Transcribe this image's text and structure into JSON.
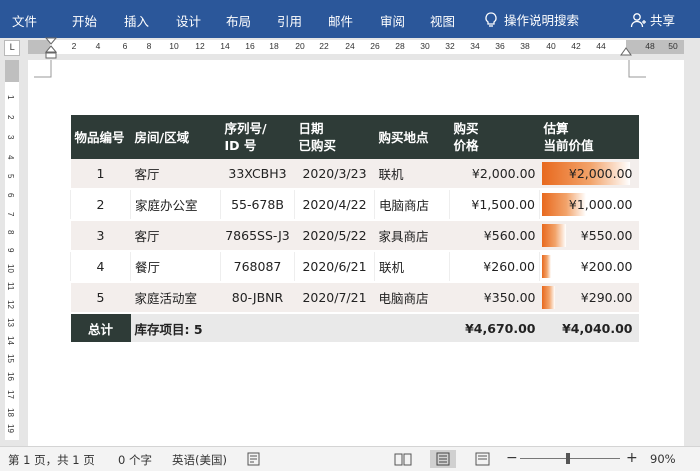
{
  "ribbon": {
    "tabs": [
      "文件",
      "开始",
      "插入",
      "设计",
      "布局",
      "引用",
      "邮件",
      "审阅",
      "视图"
    ],
    "help": "操作说明搜索",
    "share": "共享"
  },
  "ruler": {
    "corner": "L",
    "h_numbers": [
      "2",
      "4",
      "6",
      "8",
      "10",
      "12",
      "14",
      "16",
      "18",
      "20",
      "22",
      "24",
      "26",
      "28",
      "30",
      "32",
      "34",
      "36",
      "38",
      "40",
      "42",
      "44",
      "48",
      "50"
    ],
    "v_numbers": [
      "1",
      "2",
      "3",
      "4",
      "5",
      "6",
      "7",
      "8",
      "9",
      "10",
      "11",
      "12",
      "13",
      "14",
      "15",
      "16",
      "17",
      "18",
      "19"
    ]
  },
  "table": {
    "headers": [
      "物品编号",
      "房间/区域",
      "序列号/ ID 号",
      "日期 已购买",
      "购买地点",
      "购买 价格",
      "估算 当前价值"
    ],
    "rows": [
      {
        "no": "1",
        "room": "客厅",
        "serial": "33XCBH3",
        "date": "2020/3/23",
        "place": "联机",
        "price": "¥2,000.00",
        "value": "¥2,000.00",
        "value_fraction": 1.0
      },
      {
        "no": "2",
        "room": "家庭办公室",
        "serial": "55-678B",
        "date": "2020/4/22",
        "place": "电脑商店",
        "price": "¥1,500.00",
        "value": "¥1,000.00",
        "value_fraction": 0.5
      },
      {
        "no": "3",
        "room": "客厅",
        "serial": "7865SS-J3",
        "date": "2020/5/22",
        "place": "家具商店",
        "price": "¥560.00",
        "value": "¥550.00",
        "value_fraction": 0.275
      },
      {
        "no": "4",
        "room": "餐厅",
        "serial": "768087",
        "date": "2020/6/21",
        "place": "联机",
        "price": "¥260.00",
        "value": "¥200.00",
        "value_fraction": 0.1
      },
      {
        "no": "5",
        "room": "家庭活动室",
        "serial": "80-JBNR",
        "date": "2020/7/21",
        "place": "电脑商店",
        "price": "¥350.00",
        "value": "¥290.00",
        "value_fraction": 0.145
      }
    ],
    "total": {
      "label": "总计",
      "items": "库存项目: 5",
      "price": "¥4,670.00",
      "value": "¥4,040.00"
    }
  },
  "status": {
    "page": "第 1 页，共 1 页",
    "words": "0 个字",
    "lang": "英语(美国)",
    "zoom_minus": "−",
    "zoom_plus": "+",
    "zoom": "90%"
  }
}
